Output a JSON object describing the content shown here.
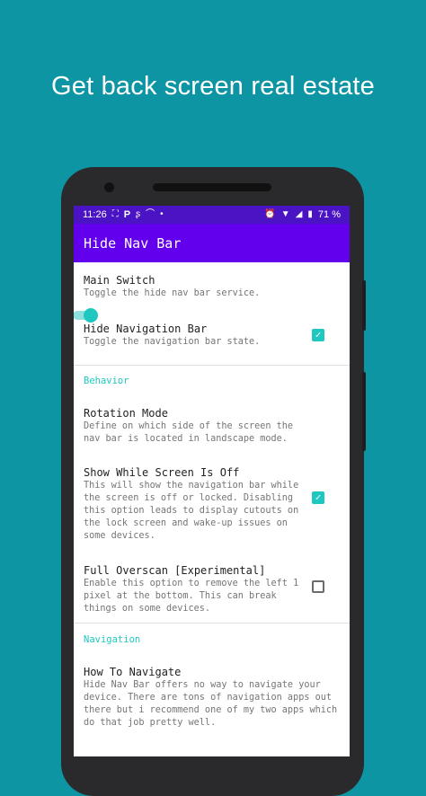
{
  "headline": "Get back screen real estate",
  "status_bar": {
    "time": "11:26",
    "left_icons": [
      "screenshot-icon",
      "parking-icon",
      "signal-app-icon",
      "cloud-icon",
      "dot-icon"
    ],
    "battery": "71 %",
    "right_icons": [
      "alarm-icon",
      "wifi-icon",
      "signal-icon",
      "battery-icon"
    ]
  },
  "app_bar": {
    "title": "Hide Nav Bar"
  },
  "sections": [
    {
      "items": [
        {
          "title": "Main Switch",
          "summary": "Toggle the hide nav bar service.",
          "control": "switch",
          "checked": true
        },
        {
          "title": "Hide Navigation Bar",
          "summary": "Toggle the navigation bar state.",
          "control": "checkbox",
          "checked": true
        }
      ]
    },
    {
      "category": "Behavior",
      "items": [
        {
          "title": "Rotation Mode",
          "summary": "Define on which side of the screen the nav bar is located in landscape mode.",
          "control": "none"
        },
        {
          "title": "Show While Screen Is Off",
          "summary": "This will show the navigation bar while the screen is off or locked. Disabling this option leads to display cutouts on the lock screen and wake-up issues on some devices.",
          "control": "checkbox",
          "checked": true
        },
        {
          "title": "Full Overscan [Experimental]",
          "summary": "Enable this option to remove the left 1 pixel at the bottom. This can break things on some devices.",
          "control": "checkbox",
          "checked": false
        }
      ]
    },
    {
      "category": "Navigation",
      "items": [
        {
          "title": "How To Navigate",
          "summary": "Hide Nav Bar offers no way to navigate your device. There are tons of navigation apps out there but i recommend one of my two apps which do that job pretty well.",
          "control": "none"
        }
      ]
    }
  ]
}
